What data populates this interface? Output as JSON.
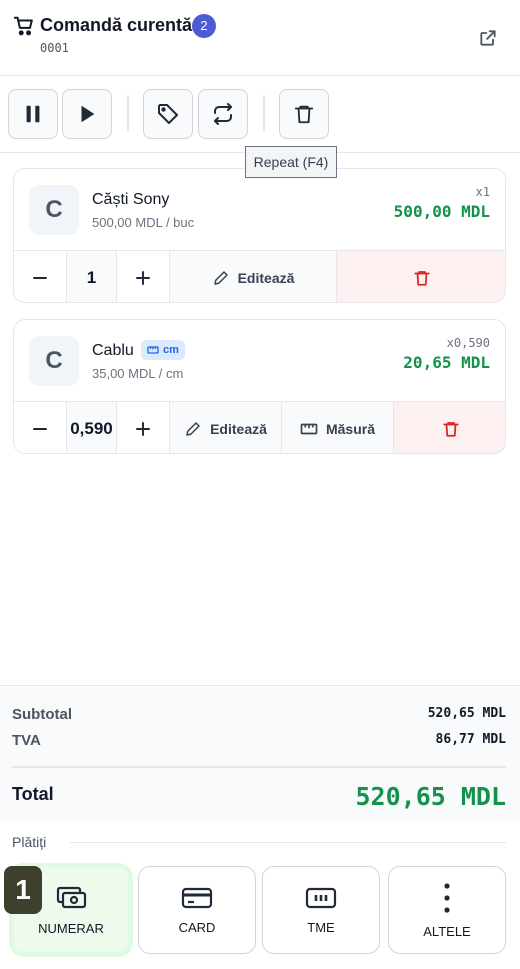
{
  "header": {
    "title": "Comandă curentă",
    "count": "2",
    "order_no": "0001"
  },
  "toolbar": {
    "buttons": [
      "pause-icon",
      "play-icon",
      "tag-icon",
      "repeat-icon",
      "trash-icon"
    ],
    "tooltip": "Repeat (F4)"
  },
  "items": [
    {
      "initial": "C",
      "name": "Căști Sony",
      "unit_price": "500,00 MDL / buc",
      "qty_tag": "x1",
      "total": "500,00 MDL",
      "quantity": "1",
      "edit_label": "Editează"
    },
    {
      "initial": "C",
      "name": "Cablu",
      "unit_badge": "cm",
      "unit_price": "35,00 MDL / cm",
      "qty_tag": "x0,590",
      "total": "20,65 MDL",
      "quantity": "0,590",
      "edit_label": "Editează",
      "measure_label": "Măsură"
    }
  ],
  "totals": {
    "subtotal_label": "Subtotal",
    "subtotal": "520,65 MDL",
    "vat_label": "TVA",
    "vat": "86,77 MDL",
    "total_label": "Total",
    "total": "520,65 MDL"
  },
  "payments": {
    "section_label": "Plătiți",
    "shortcut": "1",
    "methods": [
      "NUMERAR",
      "CARD",
      "TME",
      "ALTELE"
    ]
  },
  "colors": {
    "accent_green": "#15924a",
    "badge_blue": "#4f5bd5",
    "danger_red": "#dc2626"
  }
}
